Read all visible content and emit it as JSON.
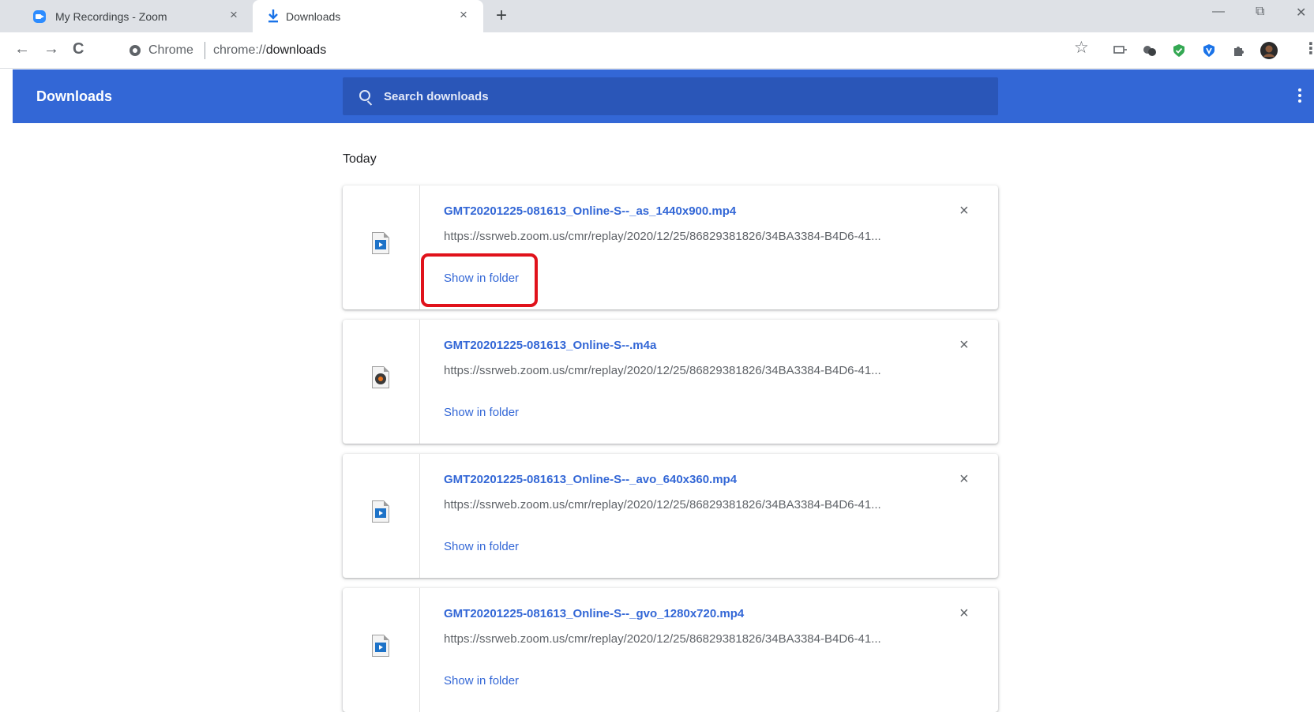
{
  "browser": {
    "tabs": [
      {
        "title": "My Recordings - Zoom",
        "close": "×"
      },
      {
        "title": "Downloads",
        "close": "×"
      }
    ],
    "new_tab": "+",
    "window_controls": {
      "minimize": "—",
      "restore": "⧉",
      "close": "✕"
    },
    "nav": {
      "back": "←",
      "forward": "→",
      "reload": "C"
    },
    "omnibox": {
      "site_label": "Chrome",
      "url_scheme": "chrome://",
      "url_host": "downloads"
    },
    "bookmark_star": "☆",
    "menu": "⋮"
  },
  "downloads": {
    "title": "Downloads",
    "search_placeholder": "Search downloads",
    "section": "Today",
    "show_in_folder_label": "Show in folder",
    "remove_label": "×",
    "items": [
      {
        "name": "GMT20201225-081613_Online-S--_as_1440x900.mp4",
        "url": "https://ssrweb.zoom.us/cmr/replay/2020/12/25/86829381826/34BA3384-B4D6-41...",
        "icon": "video-file-icon"
      },
      {
        "name": "GMT20201225-081613_Online-S--.m4a",
        "url": "https://ssrweb.zoom.us/cmr/replay/2020/12/25/86829381826/34BA3384-B4D6-41...",
        "icon": "audio-file-icon"
      },
      {
        "name": "GMT20201225-081613_Online-S--_avo_640x360.mp4",
        "url": "https://ssrweb.zoom.us/cmr/replay/2020/12/25/86829381826/34BA3384-B4D6-41...",
        "icon": "video-file-icon"
      },
      {
        "name": "GMT20201225-081613_Online-S--_gvo_1280x720.mp4",
        "url": "https://ssrweb.zoom.us/cmr/replay/2020/12/25/86829381826/34BA3384-B4D6-41...",
        "icon": "video-file-icon"
      }
    ]
  },
  "colors": {
    "header": "#3367d6",
    "search_bg": "#2a56b8",
    "link": "#3367d6",
    "highlight": "#e0121b"
  }
}
